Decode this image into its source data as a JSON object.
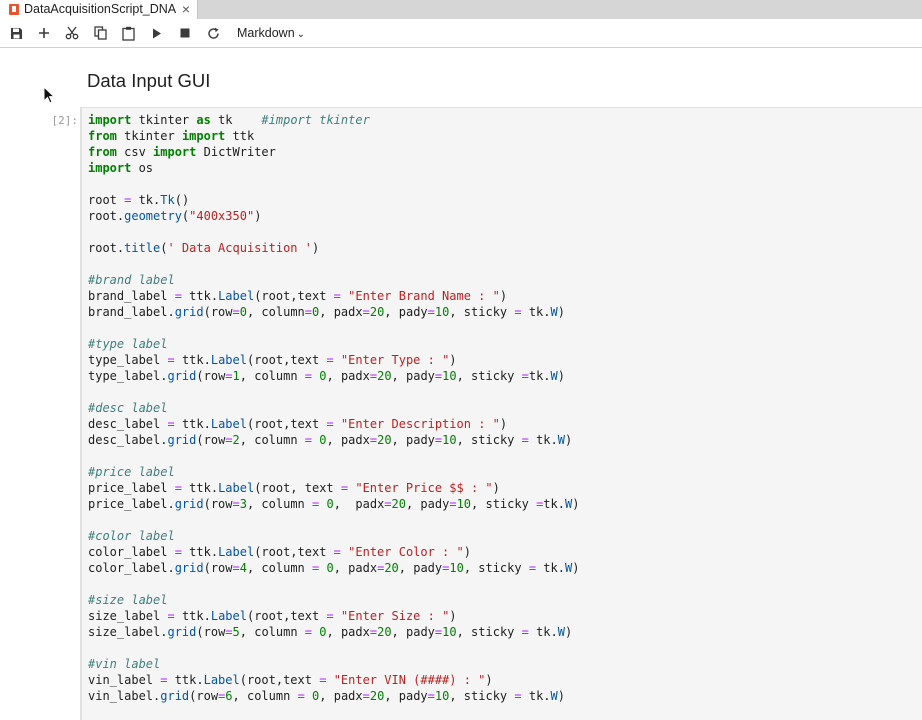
{
  "tab": {
    "title": "DataAcquisitionScript_DNA",
    "close": "×"
  },
  "toolbar": {
    "icons": [
      "save-icon",
      "add-cell-icon",
      "cut-icon",
      "copy-icon",
      "paste-icon",
      "run-icon",
      "stop-icon",
      "restart-icon"
    ],
    "cell_type": "Markdown"
  },
  "notebook": {
    "markdown_heading": "Data Input GUI",
    "cell_prompt": "[2]:",
    "code_lines": [
      [
        [
          "import",
          "kw"
        ],
        [
          " tkinter ",
          ""
        ],
        [
          "as",
          "kw"
        ],
        [
          " tk    ",
          ""
        ],
        [
          "#import tkinter",
          "cm"
        ]
      ],
      [
        [
          "from",
          "kw"
        ],
        [
          " tkinter ",
          ""
        ],
        [
          "import",
          "kw"
        ],
        [
          " ttk",
          ""
        ]
      ],
      [
        [
          "from",
          "kw"
        ],
        [
          " csv ",
          ""
        ],
        [
          "import",
          "kw"
        ],
        [
          " DictWriter",
          ""
        ]
      ],
      [
        [
          "import",
          "kw"
        ],
        [
          " os",
          ""
        ]
      ],
      [],
      [
        [
          "root ",
          ""
        ],
        [
          "=",
          "op"
        ],
        [
          " tk.",
          ""
        ],
        [
          "Tk",
          "at"
        ],
        [
          "()",
          ""
        ]
      ],
      [
        [
          "root.",
          ""
        ],
        [
          "geometry",
          "at"
        ],
        [
          "(",
          ""
        ],
        [
          "\"400x350\"",
          "st"
        ],
        [
          ")",
          ""
        ]
      ],
      [],
      [
        [
          "root.",
          ""
        ],
        [
          "title",
          "at"
        ],
        [
          "(",
          ""
        ],
        [
          "' Data Acquisition '",
          "st"
        ],
        [
          ")",
          ""
        ]
      ],
      [],
      [
        [
          "#brand label",
          "cm"
        ]
      ],
      [
        [
          "brand_label ",
          ""
        ],
        [
          "=",
          "op"
        ],
        [
          " ttk.",
          ""
        ],
        [
          "Label",
          "at"
        ],
        [
          "(root,text ",
          ""
        ],
        [
          "=",
          "op"
        ],
        [
          " ",
          ""
        ],
        [
          "\"Enter Brand Name : \"",
          "st"
        ],
        [
          ")",
          ""
        ]
      ],
      [
        [
          "brand_label.",
          ""
        ],
        [
          "grid",
          "at"
        ],
        [
          "(row",
          ""
        ],
        [
          "=",
          "op"
        ],
        [
          "0",
          "nu"
        ],
        [
          ", column",
          ""
        ],
        [
          "=",
          "op"
        ],
        [
          "0",
          "nu"
        ],
        [
          ", padx",
          ""
        ],
        [
          "=",
          "op"
        ],
        [
          "20",
          "nu"
        ],
        [
          ", pady",
          ""
        ],
        [
          "=",
          "op"
        ],
        [
          "10",
          "nu"
        ],
        [
          ", sticky ",
          ""
        ],
        [
          "=",
          "op"
        ],
        [
          " tk.",
          ""
        ],
        [
          "W",
          "at"
        ],
        [
          ")",
          ""
        ]
      ],
      [],
      [
        [
          "#type label",
          "cm"
        ]
      ],
      [
        [
          "type_label ",
          ""
        ],
        [
          "=",
          "op"
        ],
        [
          " ttk.",
          ""
        ],
        [
          "Label",
          "at"
        ],
        [
          "(root,text ",
          ""
        ],
        [
          "=",
          "op"
        ],
        [
          " ",
          ""
        ],
        [
          "\"Enter Type : \"",
          "st"
        ],
        [
          ")",
          ""
        ]
      ],
      [
        [
          "type_label.",
          ""
        ],
        [
          "grid",
          "at"
        ],
        [
          "(row",
          ""
        ],
        [
          "=",
          "op"
        ],
        [
          "1",
          "nu"
        ],
        [
          ", column ",
          ""
        ],
        [
          "=",
          "op"
        ],
        [
          " ",
          ""
        ],
        [
          "0",
          "nu"
        ],
        [
          ", padx",
          ""
        ],
        [
          "=",
          "op"
        ],
        [
          "20",
          "nu"
        ],
        [
          ", pady",
          ""
        ],
        [
          "=",
          "op"
        ],
        [
          "10",
          "nu"
        ],
        [
          ", sticky ",
          ""
        ],
        [
          "=",
          "op"
        ],
        [
          "tk.",
          ""
        ],
        [
          "W",
          "at"
        ],
        [
          ")",
          ""
        ]
      ],
      [],
      [
        [
          "#desc label",
          "cm"
        ]
      ],
      [
        [
          "desc_label ",
          ""
        ],
        [
          "=",
          "op"
        ],
        [
          " ttk.",
          ""
        ],
        [
          "Label",
          "at"
        ],
        [
          "(root,text ",
          ""
        ],
        [
          "=",
          "op"
        ],
        [
          " ",
          ""
        ],
        [
          "\"Enter Description : \"",
          "st"
        ],
        [
          ")",
          ""
        ]
      ],
      [
        [
          "desc_label.",
          ""
        ],
        [
          "grid",
          "at"
        ],
        [
          "(row",
          ""
        ],
        [
          "=",
          "op"
        ],
        [
          "2",
          "nu"
        ],
        [
          ", column ",
          ""
        ],
        [
          "=",
          "op"
        ],
        [
          " ",
          ""
        ],
        [
          "0",
          "nu"
        ],
        [
          ", padx",
          ""
        ],
        [
          "=",
          "op"
        ],
        [
          "20",
          "nu"
        ],
        [
          ", pady",
          ""
        ],
        [
          "=",
          "op"
        ],
        [
          "10",
          "nu"
        ],
        [
          ", sticky ",
          ""
        ],
        [
          "=",
          "op"
        ],
        [
          " tk.",
          ""
        ],
        [
          "W",
          "at"
        ],
        [
          ")",
          ""
        ]
      ],
      [],
      [
        [
          "#price label",
          "cm"
        ]
      ],
      [
        [
          "price_label ",
          ""
        ],
        [
          "=",
          "op"
        ],
        [
          " ttk.",
          ""
        ],
        [
          "Label",
          "at"
        ],
        [
          "(root, text ",
          ""
        ],
        [
          "=",
          "op"
        ],
        [
          " ",
          ""
        ],
        [
          "\"Enter Price $$ : \"",
          "st"
        ],
        [
          ")",
          ""
        ]
      ],
      [
        [
          "price_label.",
          ""
        ],
        [
          "grid",
          "at"
        ],
        [
          "(row",
          ""
        ],
        [
          "=",
          "op"
        ],
        [
          "3",
          "nu"
        ],
        [
          ", column ",
          ""
        ],
        [
          "=",
          "op"
        ],
        [
          " ",
          ""
        ],
        [
          "0",
          "nu"
        ],
        [
          ",  padx",
          ""
        ],
        [
          "=",
          "op"
        ],
        [
          "20",
          "nu"
        ],
        [
          ", pady",
          ""
        ],
        [
          "=",
          "op"
        ],
        [
          "10",
          "nu"
        ],
        [
          ", sticky ",
          ""
        ],
        [
          "=",
          "op"
        ],
        [
          "tk.",
          ""
        ],
        [
          "W",
          "at"
        ],
        [
          ")",
          ""
        ]
      ],
      [],
      [
        [
          "#color label",
          "cm"
        ]
      ],
      [
        [
          "color_label ",
          ""
        ],
        [
          "=",
          "op"
        ],
        [
          " ttk.",
          ""
        ],
        [
          "Label",
          "at"
        ],
        [
          "(root,text ",
          ""
        ],
        [
          "=",
          "op"
        ],
        [
          " ",
          ""
        ],
        [
          "\"Enter Color : \"",
          "st"
        ],
        [
          ")",
          ""
        ]
      ],
      [
        [
          "color_label.",
          ""
        ],
        [
          "grid",
          "at"
        ],
        [
          "(row",
          ""
        ],
        [
          "=",
          "op"
        ],
        [
          "4",
          "nu"
        ],
        [
          ", column ",
          ""
        ],
        [
          "=",
          "op"
        ],
        [
          " ",
          ""
        ],
        [
          "0",
          "nu"
        ],
        [
          ", padx",
          ""
        ],
        [
          "=",
          "op"
        ],
        [
          "20",
          "nu"
        ],
        [
          ", pady",
          ""
        ],
        [
          "=",
          "op"
        ],
        [
          "10",
          "nu"
        ],
        [
          ", sticky ",
          ""
        ],
        [
          "=",
          "op"
        ],
        [
          " tk.",
          ""
        ],
        [
          "W",
          "at"
        ],
        [
          ")",
          ""
        ]
      ],
      [],
      [
        [
          "#size label",
          "cm"
        ]
      ],
      [
        [
          "size_label ",
          ""
        ],
        [
          "=",
          "op"
        ],
        [
          " ttk.",
          ""
        ],
        [
          "Label",
          "at"
        ],
        [
          "(root,text ",
          ""
        ],
        [
          "=",
          "op"
        ],
        [
          " ",
          ""
        ],
        [
          "\"Enter Size : \"",
          "st"
        ],
        [
          ")",
          ""
        ]
      ],
      [
        [
          "size_label.",
          ""
        ],
        [
          "grid",
          "at"
        ],
        [
          "(row",
          ""
        ],
        [
          "=",
          "op"
        ],
        [
          "5",
          "nu"
        ],
        [
          ", column ",
          ""
        ],
        [
          "=",
          "op"
        ],
        [
          " ",
          ""
        ],
        [
          "0",
          "nu"
        ],
        [
          ", padx",
          ""
        ],
        [
          "=",
          "op"
        ],
        [
          "20",
          "nu"
        ],
        [
          ", pady",
          ""
        ],
        [
          "=",
          "op"
        ],
        [
          "10",
          "nu"
        ],
        [
          ", sticky ",
          ""
        ],
        [
          "=",
          "op"
        ],
        [
          " tk.",
          ""
        ],
        [
          "W",
          "at"
        ],
        [
          ")",
          ""
        ]
      ],
      [],
      [
        [
          "#vin label",
          "cm"
        ]
      ],
      [
        [
          "vin_label ",
          ""
        ],
        [
          "=",
          "op"
        ],
        [
          " ttk.",
          ""
        ],
        [
          "Label",
          "at"
        ],
        [
          "(root,text ",
          ""
        ],
        [
          "=",
          "op"
        ],
        [
          " ",
          ""
        ],
        [
          "\"Enter VIN (####) : \"",
          "st"
        ],
        [
          ")",
          ""
        ]
      ],
      [
        [
          "vin_label.",
          ""
        ],
        [
          "grid",
          "at"
        ],
        [
          "(row",
          ""
        ],
        [
          "=",
          "op"
        ],
        [
          "6",
          "nu"
        ],
        [
          ", column ",
          ""
        ],
        [
          "=",
          "op"
        ],
        [
          " ",
          ""
        ],
        [
          "0",
          "nu"
        ],
        [
          ", padx",
          ""
        ],
        [
          "=",
          "op"
        ],
        [
          "20",
          "nu"
        ],
        [
          ", pady",
          ""
        ],
        [
          "=",
          "op"
        ],
        [
          "10",
          "nu"
        ],
        [
          ", sticky ",
          ""
        ],
        [
          "=",
          "op"
        ],
        [
          " tk.",
          ""
        ],
        [
          "W",
          "at"
        ],
        [
          ")",
          ""
        ]
      ]
    ]
  },
  "colors": {
    "keyword": "#008000",
    "comment": "#3f7f7f",
    "string": "#ba2121",
    "operator": "#aa22ff",
    "attribute": "#0055aa",
    "code_background": "#f5f5f5"
  }
}
